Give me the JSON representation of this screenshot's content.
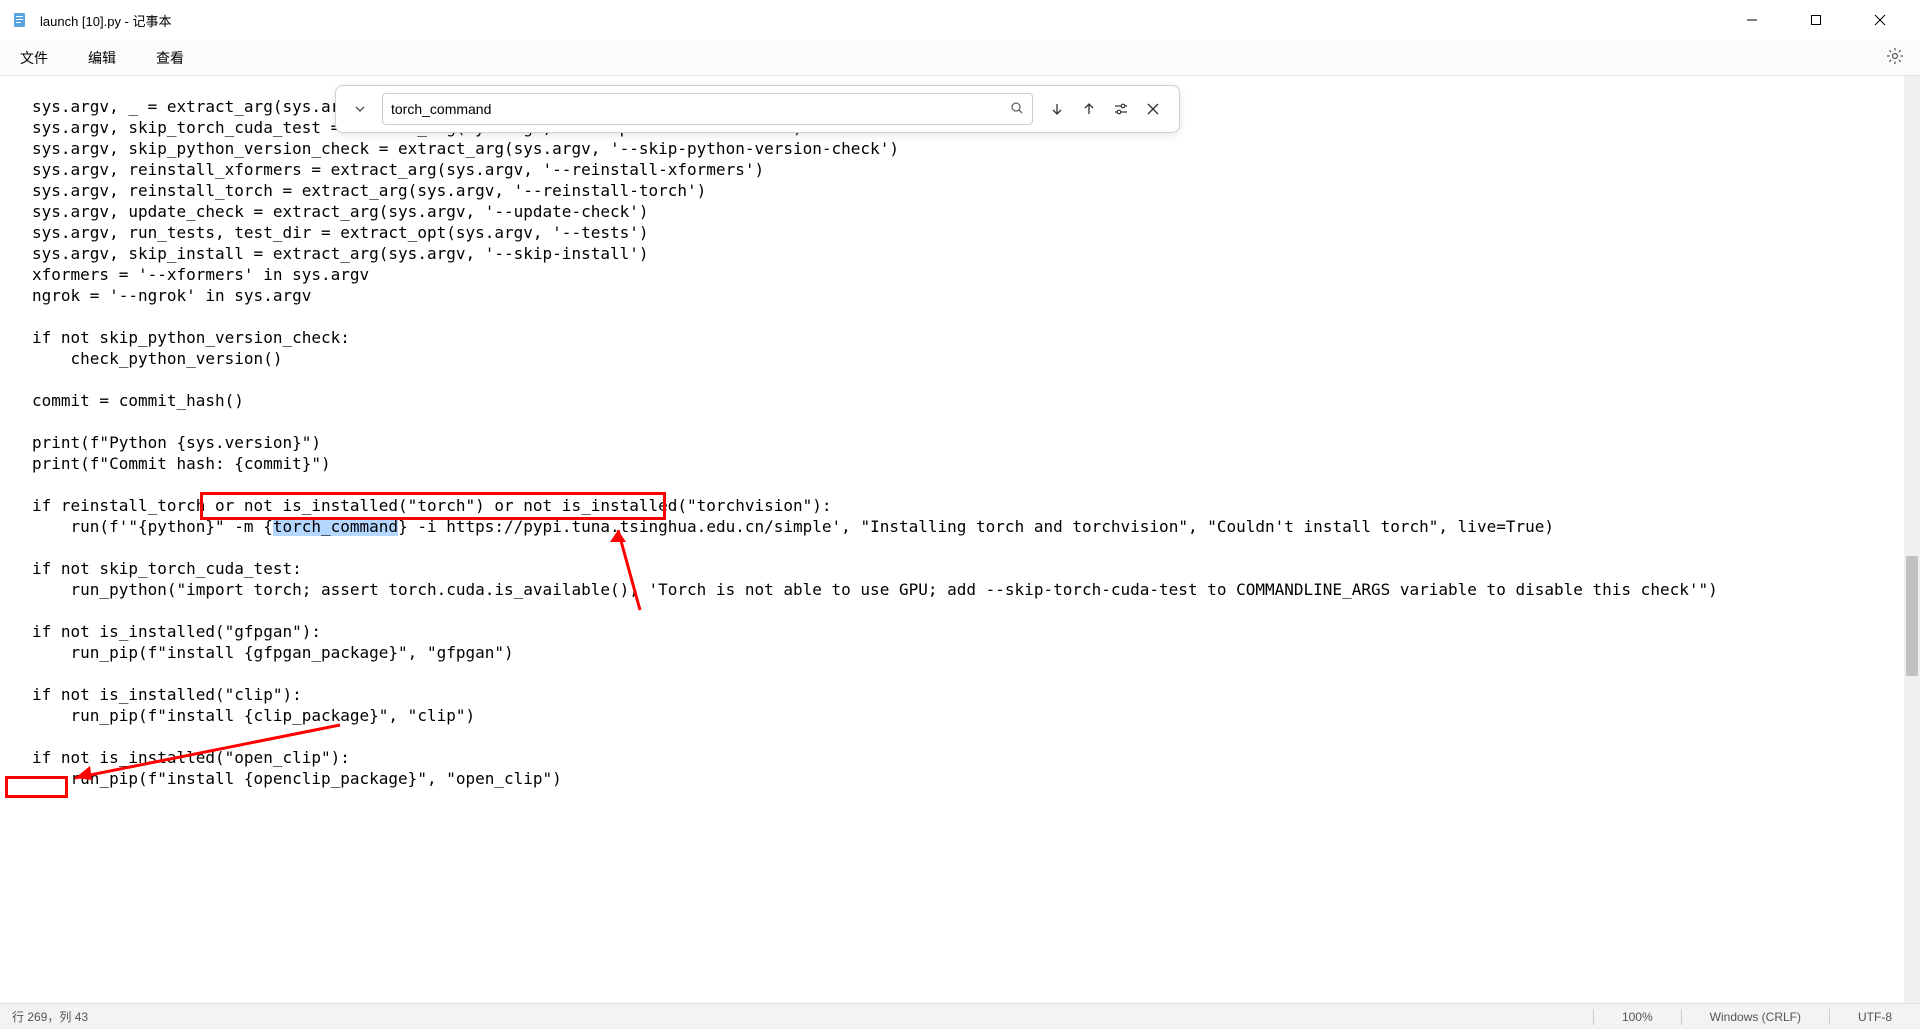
{
  "window": {
    "title": "launch [10].py - 记事本"
  },
  "menu": {
    "file": "文件",
    "edit": "编辑",
    "view": "查看"
  },
  "find": {
    "value": "torch_command"
  },
  "code": {
    "line1": "sys.argv, _ = extract_arg(sys.argv, '-f')",
    "line2": "sys.argv, skip_torch_cuda_test = extract_arg(sys.argv, '--skip-torch-cuda-test')",
    "line3": "sys.argv, skip_python_version_check = extract_arg(sys.argv, '--skip-python-version-check')",
    "line4": "sys.argv, reinstall_xformers = extract_arg(sys.argv, '--reinstall-xformers')",
    "line5": "sys.argv, reinstall_torch = extract_arg(sys.argv, '--reinstall-torch')",
    "line6": "sys.argv, update_check = extract_arg(sys.argv, '--update-check')",
    "line7": "sys.argv, run_tests, test_dir = extract_opt(sys.argv, '--tests')",
    "line8": "sys.argv, skip_install = extract_arg(sys.argv, '--skip-install')",
    "line9": "xformers = '--xformers' in sys.argv",
    "line10": "ngrok = '--ngrok' in sys.argv",
    "line11": "",
    "line12": "if not skip_python_version_check:",
    "line13": "    check_python_version()",
    "line14": "",
    "line15": "commit = commit_hash()",
    "line16": "",
    "line17": "print(f\"Python {sys.version}\")",
    "line18": "print(f\"Commit hash: {commit}\")",
    "line19": "",
    "line20": "if reinstall_torch or not is_installed(\"torch\") or not is_installed(\"torchvision\"):",
    "line21_a": "    run(f'\"{python}\" -m {",
    "line21_b": "torch_command",
    "line21_c": "} -i https://pypi.tuna.tsinghua.edu.cn/simple', \"Installing torch and torchvision\", \"Couldn't install torch\", live=True)",
    "line22": "",
    "line23": "if not skip_torch_cuda_test:",
    "line24": "    run_python(\"import torch; assert torch.cuda.is_available(), 'Torch is not able to use GPU; add --skip-torch-cuda-test to COMMANDLINE_ARGS variable to disable this check'\")",
    "line25": "",
    "line26": "if not is_installed(\"gfpgan\"):",
    "line27": "    run_pip(f\"install {gfpgan_package}\", \"gfpgan\")",
    "line28": "",
    "line29": "if not is_installed(\"clip\"):",
    "line30": "    run_pip(f\"install {clip_package}\", \"clip\")",
    "line31": "",
    "line32": "if not is_installed(\"open_clip\"):",
    "line33": "    run_pip(f\"install {openclip_package}\", \"open_clip\")"
  },
  "status": {
    "position": "行 269，列 43",
    "zoom": "100%",
    "lineending": "Windows (CRLF)",
    "encoding": "UTF-8"
  }
}
